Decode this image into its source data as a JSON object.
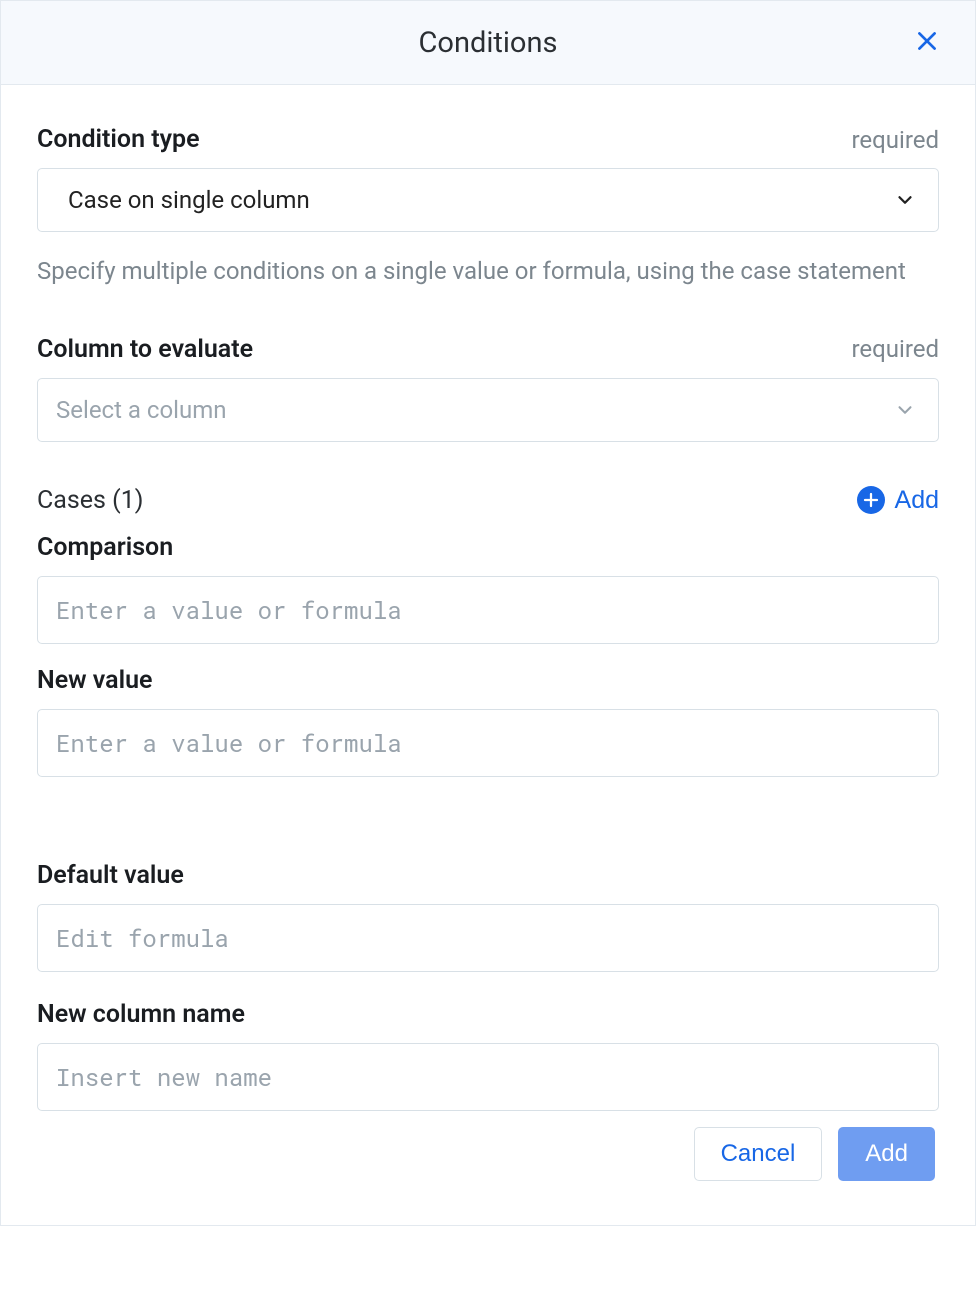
{
  "header": {
    "title": "Conditions"
  },
  "condition_type": {
    "label": "Condition type",
    "required_tag": "required",
    "value": "Case on single column",
    "help": "Specify multiple conditions on a single value or formula, using the case statement"
  },
  "column_to_evaluate": {
    "label": "Column to evaluate",
    "required_tag": "required",
    "placeholder": "Select a column"
  },
  "cases": {
    "title": "Cases (1)",
    "add_label": "Add",
    "comparison_label": "Comparison",
    "comparison_placeholder": "Enter a value or formula",
    "new_value_label": "New value",
    "new_value_placeholder": "Enter a value or formula"
  },
  "default_value": {
    "label": "Default value",
    "placeholder": "Edit formula"
  },
  "new_column": {
    "label": "New column name",
    "placeholder": "Insert new name"
  },
  "footer": {
    "cancel": "Cancel",
    "add": "Add"
  }
}
